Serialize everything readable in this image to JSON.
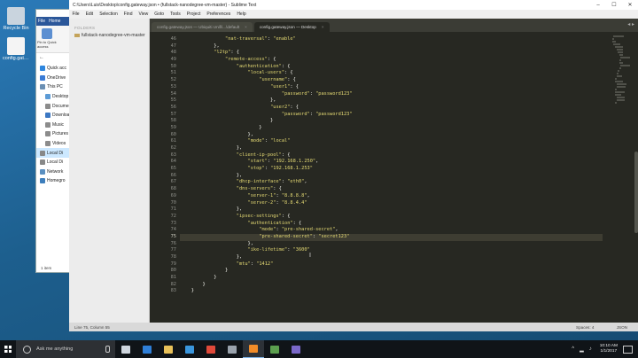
{
  "desktop": {
    "icons": [
      {
        "label": "Recycle Bin"
      },
      {
        "label": "config.gatew..."
      }
    ]
  },
  "explorer": {
    "ribbon_tabs": [
      "File",
      "Home"
    ],
    "pin_label": "Pin to Quick access",
    "nav_back": "←",
    "items": [
      {
        "label": "Quick acc",
        "color": "#2e86de"
      },
      {
        "label": "OneDrive",
        "color": "#3a7bd5"
      },
      {
        "label": "This PC",
        "color": "#6b8fb3"
      },
      {
        "label": "Desktop",
        "color": "#5c9bd6"
      },
      {
        "label": "Documen",
        "color": "#8c8c8c"
      },
      {
        "label": "Downloa",
        "color": "#3c78c3"
      },
      {
        "label": "Music",
        "color": "#8c8c8c"
      },
      {
        "label": "Pictures",
        "color": "#8c8c8c"
      },
      {
        "label": "Videos",
        "color": "#8c8c8c"
      },
      {
        "label": "Local Di",
        "color": "#888888"
      },
      {
        "label": "Local Di",
        "color": "#888888"
      },
      {
        "label": "Network",
        "color": "#5a8fc0"
      },
      {
        "label": "Homegro",
        "color": "#3d7ebc"
      }
    ],
    "status": "1 item"
  },
  "sublime": {
    "title": "C:\\Users\\Luis\\Desktop\\config.gateway.json • (fullstack-nanodegree-vm-master) - Sublime Text",
    "menu": [
      "File",
      "Edit",
      "Selection",
      "Find",
      "View",
      "Goto",
      "Tools",
      "Project",
      "Preferences",
      "Help"
    ],
    "sidebar": {
      "header": "FOLDERS",
      "folder": "fullstack-nanodegree-vm-master"
    },
    "tabs": [
      {
        "label": "config.gateway.json — Ubiquiti Unifi\\...\\default",
        "active": false
      },
      {
        "label": "config.gateway.json — Desktop",
        "active": true
      }
    ],
    "tab_close": "×",
    "tab_nav": "◂ ▸",
    "status_left": "Line 75, Column 55",
    "status_right": [
      "Spaces: 4",
      "JSON"
    ]
  },
  "editor": {
    "current_line": 75,
    "lines": [
      {
        "n": "46",
        "text": "                \"nat-traversal\": \"enable\""
      },
      {
        "n": "47",
        "text": "            },"
      },
      {
        "n": "48",
        "text": "            \"l2tp\": {"
      },
      {
        "n": "49",
        "text": "                \"remote-access\": {"
      },
      {
        "n": "50",
        "text": "                    \"authentication\": {"
      },
      {
        "n": "51",
        "text": "                        \"local-users\": {"
      },
      {
        "n": "52",
        "text": "                            \"username\": {"
      },
      {
        "n": "53",
        "text": "                                \"user1\": {"
      },
      {
        "n": "54",
        "text": "                                    \"password\": \"password123\""
      },
      {
        "n": "55",
        "text": "                                },"
      },
      {
        "n": "56",
        "text": "                                \"user2\": {"
      },
      {
        "n": "57",
        "text": "                                    \"password\": \"password123\""
      },
      {
        "n": "58",
        "text": "                                }"
      },
      {
        "n": "59",
        "text": "                            }"
      },
      {
        "n": "60",
        "text": "                        },"
      },
      {
        "n": "61",
        "text": "                        \"mode\": \"local\""
      },
      {
        "n": "62",
        "text": "                    },"
      },
      {
        "n": "63",
        "text": "                    \"client-ip-pool\": {"
      },
      {
        "n": "64",
        "text": "                        \"start\": \"192.168.1.250\","
      },
      {
        "n": "65",
        "text": "                        \"stop\": \"192.168.1.253\""
      },
      {
        "n": "66",
        "text": "                    },"
      },
      {
        "n": "67",
        "text": "                    \"dhcp-interface\": \"eth0\","
      },
      {
        "n": "68",
        "text": "                    \"dns-servers\": {"
      },
      {
        "n": "69",
        "text": "                        \"server-1\": \"8.8.8.8\","
      },
      {
        "n": "70",
        "text": "                        \"server-2\": \"8.8.4.4\""
      },
      {
        "n": "71",
        "text": "                    },"
      },
      {
        "n": "72",
        "text": "                    \"ipsec-settings\": {"
      },
      {
        "n": "73",
        "text": "                        \"authentication\": {"
      },
      {
        "n": "74",
        "text": "                            \"mode\": \"pre-shared-secret\","
      },
      {
        "n": "75",
        "text": "                            \"pre-shared-secret\": \"secret123\""
      },
      {
        "n": "76",
        "text": "                        },"
      },
      {
        "n": "77",
        "text": "                        \"ike-lifetime\": \"3600\""
      },
      {
        "n": "78",
        "text": "                    },"
      },
      {
        "n": "79",
        "text": "                    \"mtu\": \"1412\""
      },
      {
        "n": "80",
        "text": "                }"
      },
      {
        "n": "81",
        "text": "            }"
      },
      {
        "n": "82",
        "text": "        }"
      },
      {
        "n": "83",
        "text": "    }"
      }
    ]
  },
  "taskbar": {
    "search_placeholder": "Ask me anything",
    "apps": [
      {
        "name": "task-view-icon",
        "color": "#cfd6de"
      },
      {
        "name": "edge-icon",
        "color": "#2f7fd8"
      },
      {
        "name": "file-explorer-icon",
        "color": "#e8c15a"
      },
      {
        "name": "store-icon",
        "color": "#3a96dd"
      },
      {
        "name": "chrome-icon",
        "color": "#e0493a"
      },
      {
        "name": "terminal-icon",
        "color": "#9aa3ad"
      },
      {
        "name": "sublime-icon",
        "color": "#f28c28"
      },
      {
        "name": "app-icon",
        "color": "#5c9f4f"
      },
      {
        "name": "app-icon-2",
        "color": "#7a68c9"
      }
    ],
    "time": "10:10 AM",
    "date": "1/1/2017",
    "tray_chevron": "^"
  },
  "colors": {
    "editor_bg": "#272822",
    "string": "#e6db74",
    "text": "#f8f8f2",
    "accent": "#2b579a"
  }
}
